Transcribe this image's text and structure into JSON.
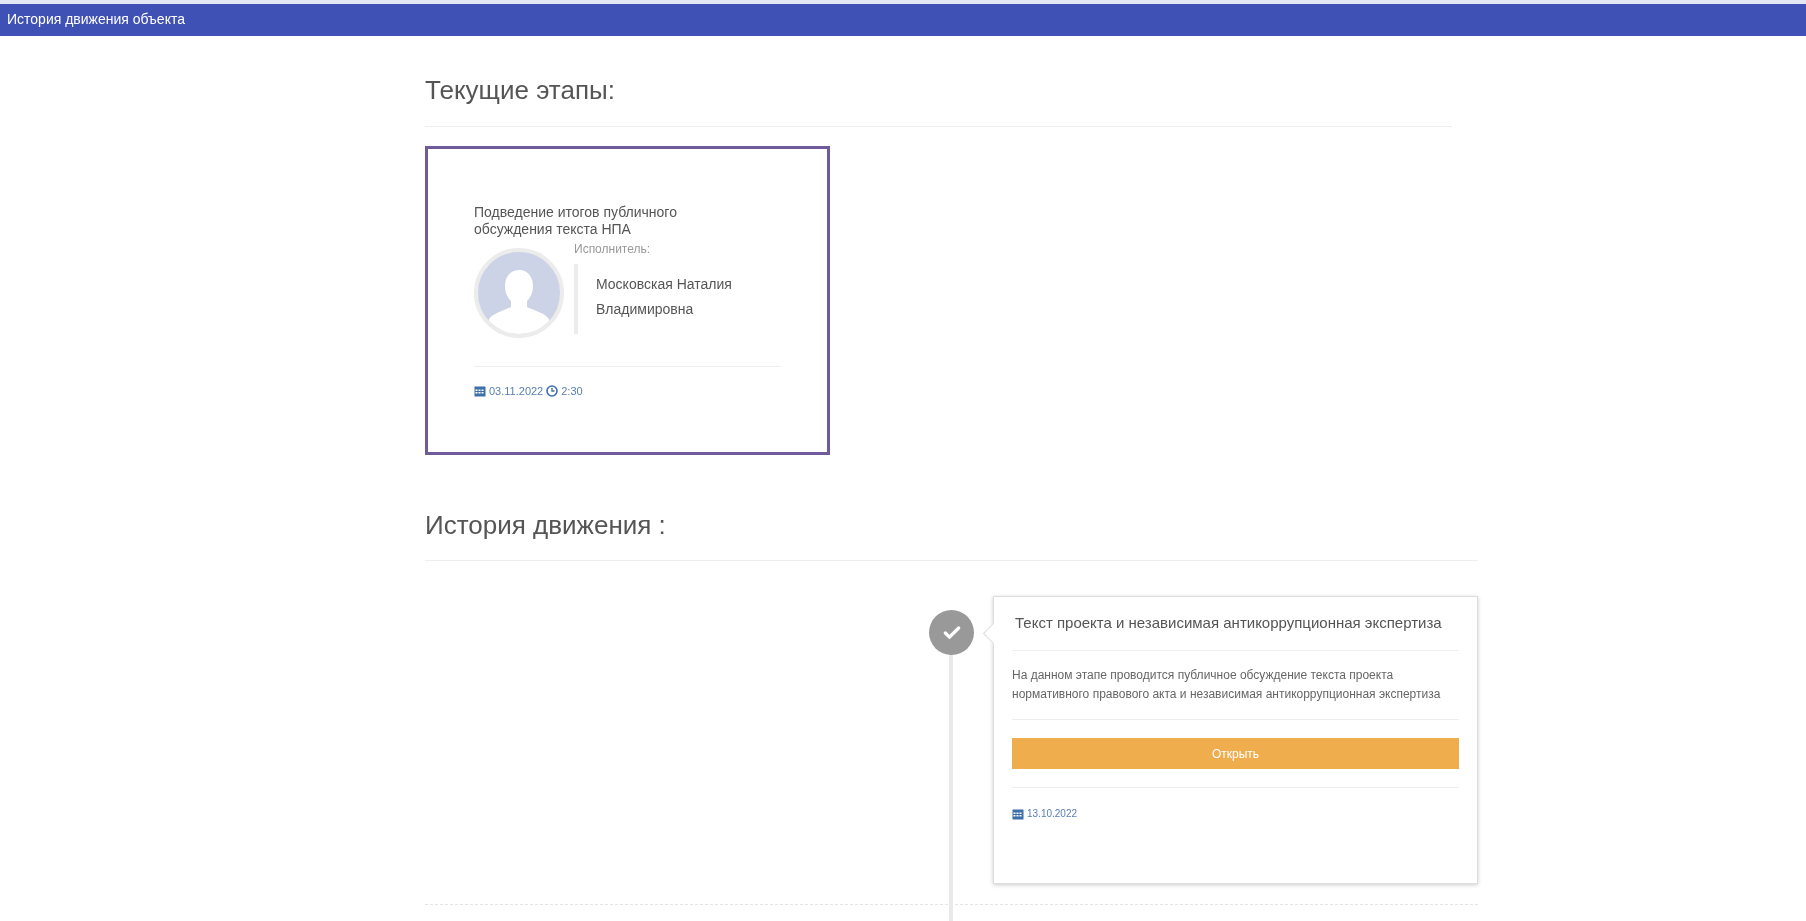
{
  "header": {
    "title": "История движения объекта"
  },
  "current": {
    "heading": "Текущие этапы:",
    "stages": [
      {
        "title": "Подведение итогов публичного обсуждения текста НПА",
        "performer_label": "Исполнитель:",
        "performer": "Московская Наталия Владимировна",
        "date": "03.11.2022",
        "time": "2:30"
      }
    ]
  },
  "history": {
    "heading": "История движения :",
    "items": [
      {
        "title": "Текст проекта и независимая антикоррупционная экспертиза",
        "description": "На данном этапе проводится публичное обсуждение текста проекта нормативного правового акта и независимая антикоррупционная экспертиза",
        "button": "Открыть",
        "date": "13.10.2022"
      }
    ]
  }
}
